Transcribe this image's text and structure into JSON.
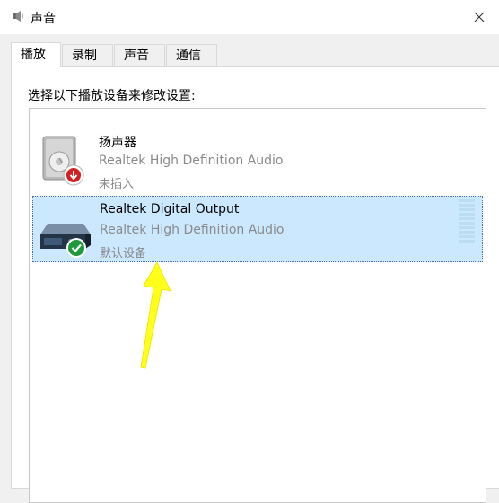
{
  "window": {
    "title": "声音"
  },
  "tabs": [
    {
      "label": "播放",
      "active": true
    },
    {
      "label": "录制",
      "active": false
    },
    {
      "label": "声音",
      "active": false
    },
    {
      "label": "通信",
      "active": false
    }
  ],
  "panel": {
    "instruction": "选择以下播放设备来修改设置:"
  },
  "devices": [
    {
      "name": "扬声器",
      "driver": "Realtek High Definition Audio",
      "status": "未插入",
      "icon": "speaker-icon",
      "badge": "red-down-arrow-badge",
      "selected": false
    },
    {
      "name": "Realtek Digital Output",
      "driver": "Realtek High Definition Audio",
      "status": "默认设备",
      "icon": "digital-output-icon",
      "badge": "green-check-badge",
      "selected": true
    }
  ],
  "colors": {
    "selection": "#cce8ff",
    "annotation_arrow": "#ffff00",
    "badge_red": "#d32020",
    "badge_green": "#1f9a3a"
  }
}
